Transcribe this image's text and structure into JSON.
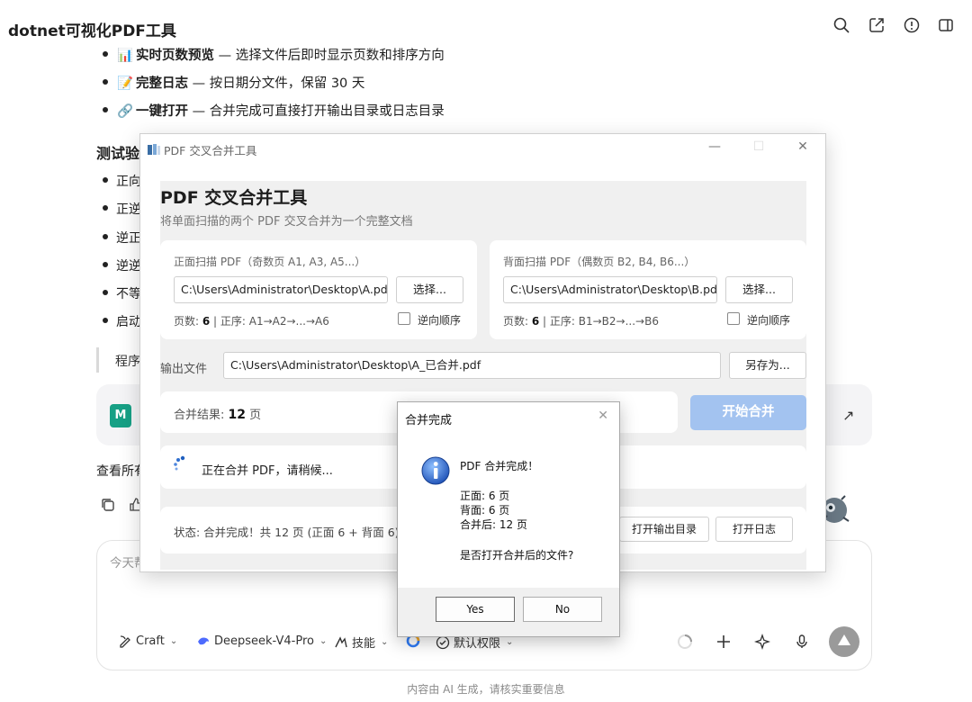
{
  "topbar": {
    "title": "dotnet可视化PDF工具",
    "icons": [
      "search-icon",
      "share-icon",
      "info-icon",
      "sidebar-icon"
    ]
  },
  "chat": {
    "features": [
      {
        "emoji": "📊",
        "title": "实时页数预览",
        "desc": " — 选择文件后即时显示页数和排序方向"
      },
      {
        "emoji": "📝",
        "title": "完整日志",
        "desc": " — 按日期分文件，保留 30 天"
      },
      {
        "emoji": "🔗",
        "title": "一键打开",
        "desc": " — 合并完成可直接打开输出目录或日志目录"
      }
    ],
    "section_title": "测试验",
    "test_items": [
      "正向",
      "正逆",
      "逆正",
      "逆逆",
      "不等",
      "启动"
    ],
    "quote": "程序",
    "file_icon_text": "M",
    "card_arrow": "↗",
    "view_all": "查看所有",
    "input_placeholder": "今天帮",
    "toolbar": {
      "craft": "Craft",
      "model": "Deepseek-V4-Pro",
      "skills": "技能",
      "permission": "默认权限"
    },
    "footer": "内容由 AI 生成，请核实重要信息"
  },
  "pdf_window": {
    "title": "PDF 交叉合并工具",
    "heading": "PDF 交叉合并工具",
    "subtitle": "将单面扫描的两个 PDF 交叉合并为一个完整文档",
    "front": {
      "label": "正面扫描 PDF（奇数页 A1, A3, A5...）",
      "path": "C:\\Users\\Administrator\\Desktop\\A.pdf",
      "select": "选择...",
      "pages_label": "页数: ",
      "pages": "6",
      "order": " | 正序: A1→A2→...→A6",
      "reverse": "逆向顺序"
    },
    "back": {
      "label": "背面扫描 PDF（偶数页 B2, B4, B6...）",
      "path": "C:\\Users\\Administrator\\Desktop\\B.pdf",
      "select": "选择...",
      "pages_label": "页数: ",
      "pages": "6",
      "order": " | 正序: B1→B2→...→B6",
      "reverse": "逆向顺序"
    },
    "output": {
      "label": "输出文件",
      "path": "C:\\Users\\Administrator\\Desktop\\A_已合并.pdf",
      "save_as": "另存为..."
    },
    "result": {
      "label": "合并结果: ",
      "count": "12",
      "unit": " 页"
    },
    "start_button": "开始合并",
    "progress": "正在合并 PDF，请稍候...",
    "status": "状态: 合并完成！共 12 页 (正面 6 + 背面 6)",
    "open_output": "打开输出目录",
    "open_log": "打开日志"
  },
  "dialog": {
    "title": "合并完成",
    "line1": "PDF 合并完成！",
    "front": "正面: 6 页",
    "back": "背面: 6 页",
    "merged": "合并后: 12 页",
    "question": "是否打开合并后的文件?",
    "yes": "Yes",
    "no": "No"
  }
}
